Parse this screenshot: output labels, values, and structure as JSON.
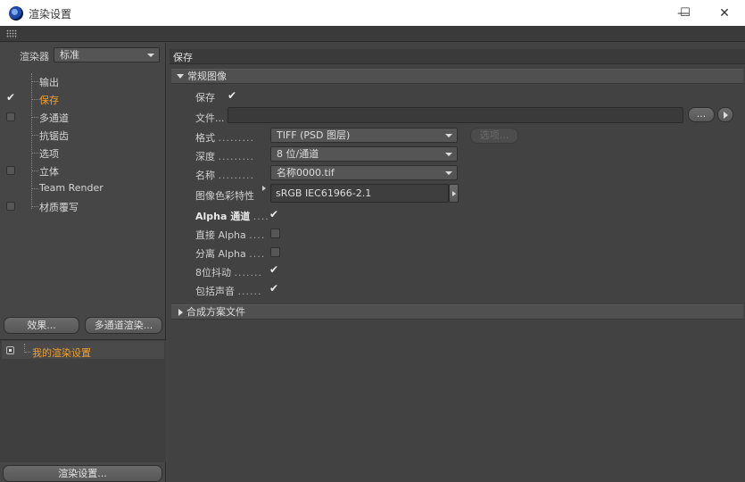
{
  "window": {
    "title": "渲染设置",
    "icon": "cinema4d-logo-icon",
    "controls": {
      "minimize": "—",
      "maximize": "☐",
      "close": "✕"
    }
  },
  "left": {
    "renderer_label": "渲染器",
    "renderer_value": "标准",
    "tree": [
      {
        "label": "输出",
        "checkbox": "none",
        "selected": false
      },
      {
        "label": "保存",
        "checkbox": "checked",
        "selected": true
      },
      {
        "label": "多通道",
        "checkbox": "unchecked",
        "selected": false
      },
      {
        "label": "抗锯齿",
        "checkbox": "none",
        "selected": false
      },
      {
        "label": "选项",
        "checkbox": "none",
        "selected": false
      },
      {
        "label": "立体",
        "checkbox": "unchecked",
        "selected": false
      },
      {
        "label": "Team Render",
        "checkbox": "none",
        "selected": false
      },
      {
        "label": "材质覆写",
        "checkbox": "unchecked",
        "selected": false
      }
    ],
    "effects_button": "效果...",
    "multipass_button": "多通道渲染...",
    "settings_list": [
      {
        "label": "我的渲染设置",
        "active": true
      }
    ],
    "render_settings_button": "渲染设置..."
  },
  "right": {
    "header": "保存",
    "section_regular_image": "常规图像",
    "save_label": "保存",
    "save_checked": true,
    "file_label": "文件...",
    "file_value": "",
    "file_browse_button": "...",
    "format_label": "格式",
    "format_value": "TIFF (PSD 图层)",
    "options_button": "选项...",
    "depth_label": "深度",
    "depth_value": "8 位/通道",
    "name_label": "名称",
    "name_value": "名称0000.tif",
    "color_profile_label": "图像色彩特性",
    "color_profile_value": "sRGB IEC61966-2.1",
    "alpha_channel_label": "Alpha 通道",
    "alpha_channel_checked": true,
    "straight_alpha_label": "直接 Alpha",
    "straight_alpha_checked": false,
    "separate_alpha_label": "分离 Alpha",
    "separate_alpha_checked": false,
    "dither_label": "8位抖动",
    "dither_checked": true,
    "include_sound_label": "包括声音",
    "include_sound_checked": true,
    "section_compositing": "合成方案文件"
  },
  "colors": {
    "selected_text": "#f0a030",
    "panel_bg": "#424242"
  }
}
